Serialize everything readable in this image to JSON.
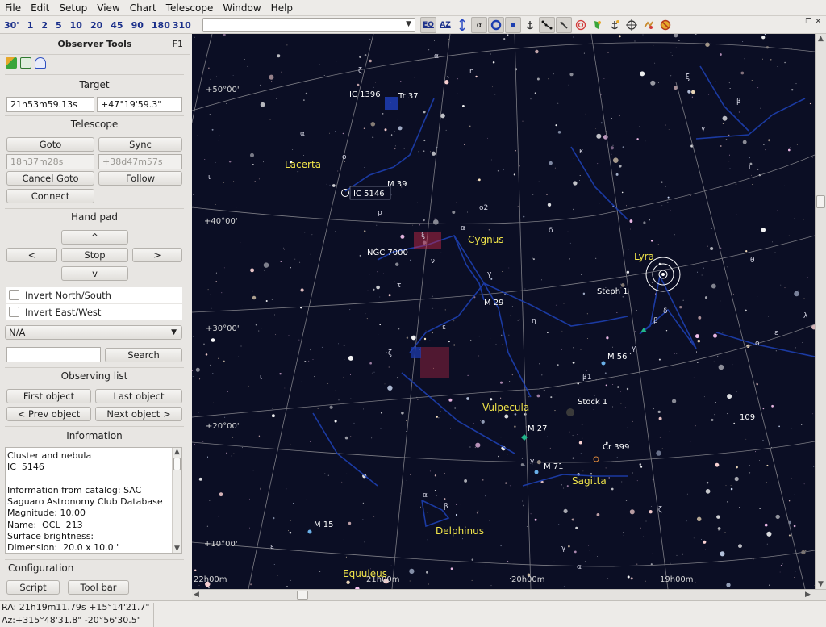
{
  "menubar": {
    "items": [
      "File",
      "Edit",
      "Setup",
      "View",
      "Chart",
      "Telescope",
      "Window",
      "Help"
    ]
  },
  "toolbar": {
    "fov_buttons": [
      "30'",
      "1",
      "2",
      "5",
      "10",
      "20",
      "45",
      "90",
      "180",
      "310"
    ],
    "search_value": "",
    "icons": [
      "eq-icon",
      "az-icon",
      "flip-icon",
      "alpha-label-icon",
      "galaxy-icon",
      "star-icon",
      "anchor-icon",
      "constellation-icon",
      "lines-icon",
      "target-icon",
      "object-icon",
      "anchor2-icon",
      "crosshair-icon",
      "dso-icon",
      "no-icon"
    ],
    "eq_label": "EQ",
    "az_label": "AZ",
    "alpha_label": "α"
  },
  "panel": {
    "title": "Observer Tools",
    "shortcut": "F1",
    "target": {
      "title": "Target",
      "ra": "21h53m59.13s",
      "dec": "+47°19'59.3\""
    },
    "telescope": {
      "title": "Telescope",
      "goto": "Goto",
      "sync": "Sync",
      "ra": "18h37m28s",
      "dec": "+38d47m57s",
      "cancel_goto": "Cancel Goto",
      "follow": "Follow",
      "connect": "Connect"
    },
    "handpad": {
      "title": "Hand pad",
      "up": "^",
      "left": "<",
      "stop": "Stop",
      "right": ">",
      "down": "v",
      "invert_ns": "Invert North/South",
      "invert_ew": "Invert East/West"
    },
    "select_value": "N/A",
    "search_input": "",
    "search_button": "Search",
    "observing": {
      "title": "Observing list",
      "first": "First object",
      "last": "Last object",
      "prev": "< Prev object",
      "next": "Next object >"
    },
    "information": {
      "title": "Information",
      "text": "Cluster and nebula\nIC  5146\n\nInformation from catalog: SAC\nSaguaro Astronomy Club Database\nMagnitude: 10.00\nName:  OCL  213\nSurface brightness:\nDimension:  20.0 x 10.0 '"
    },
    "configuration": {
      "title": "Configuration",
      "script": "Script",
      "toolbar": "Tool bar"
    }
  },
  "status": {
    "line1": "RA: 21h19m11.79s +15°14'21.7\"",
    "line2": "Az:+315°48'31.8\" -20°56'30.5\""
  },
  "chart": {
    "constellations": [
      "Lacerta",
      "Cygnus",
      "Lyra",
      "Vulpecula",
      "Sagitta",
      "Delphinus",
      "Equuleus"
    ],
    "objects": [
      "IC 1396",
      "Tr 37",
      "IC 5146",
      "M 39",
      "NGC 7000",
      "M 29",
      "Steph 1",
      "M 56",
      "Stock 1",
      "M 27",
      "Cr 399",
      "M 71",
      "M 15",
      "109"
    ],
    "dec_labels": [
      "+50°00'",
      "+40°00'",
      "+30°00'",
      "+20°00'",
      "+10°00'"
    ],
    "ra_labels": [
      "22h00m",
      "21h00m",
      "20h00m",
      "19h00m"
    ],
    "greek": [
      "α",
      "ζ",
      "η",
      "ξ",
      "β",
      "γ",
      "κ",
      "ι",
      "o2",
      "ρ",
      "δ",
      "ξ",
      "ν",
      "τ",
      "α",
      "γ",
      "θ",
      "ε",
      "η",
      "ζ",
      "β1",
      "γ",
      "α",
      "β",
      "ε",
      "ζ",
      "γ",
      "α",
      "ι",
      "λ",
      "o",
      "ι",
      "β",
      "α",
      "ε",
      "γ",
      "o",
      "δ"
    ],
    "colors": {
      "sky": "#0b0e24",
      "constellation_line": "#1d3fb0",
      "grid": "#8a8a8a",
      "constellation_label": "#f2e64a",
      "object_label": "#ffffff"
    }
  }
}
